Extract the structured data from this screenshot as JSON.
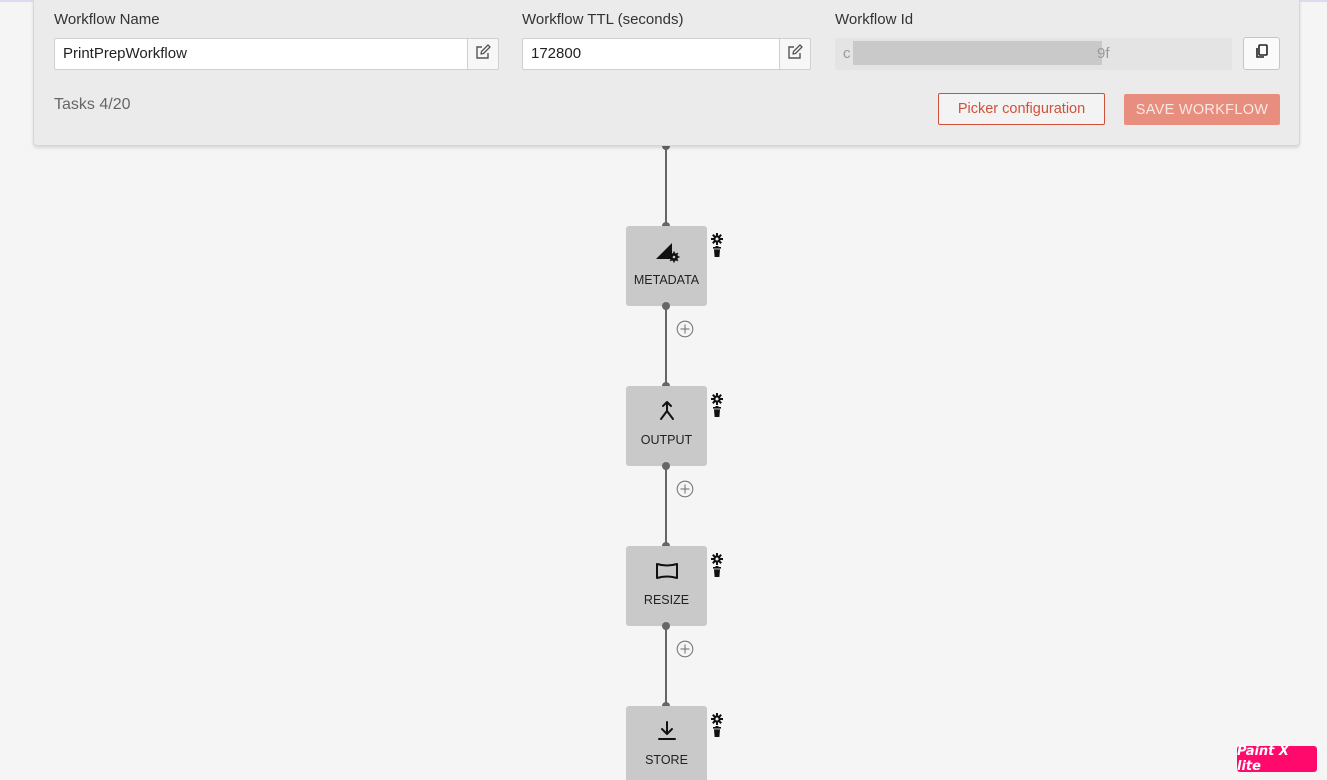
{
  "form": {
    "name_label": "Workflow Name",
    "name_value": "PrintPrepWorkflow",
    "ttl_label": "Workflow TTL (seconds)",
    "ttl_value": "172800",
    "id_label": "Workflow Id",
    "id_prefix": "c",
    "id_suffix": "9f",
    "tasks_count": "Tasks 4/20",
    "picker_label": "Picker configuration",
    "save_label": "SAVE WORKFLOW"
  },
  "tasks": [
    {
      "label": "METADATA",
      "icon": "metadata-icon"
    },
    {
      "label": "OUTPUT",
      "icon": "merge-icon"
    },
    {
      "label": "RESIZE",
      "icon": "resize-icon"
    },
    {
      "label": "STORE",
      "icon": "download-icon"
    }
  ],
  "badge": "Paint X lite",
  "colors": {
    "accent": "#d0513a",
    "save_disabled": "#e88e7e",
    "node_bg": "#c9c9c9",
    "edge": "#666666",
    "badge": "#ff0a6c"
  }
}
